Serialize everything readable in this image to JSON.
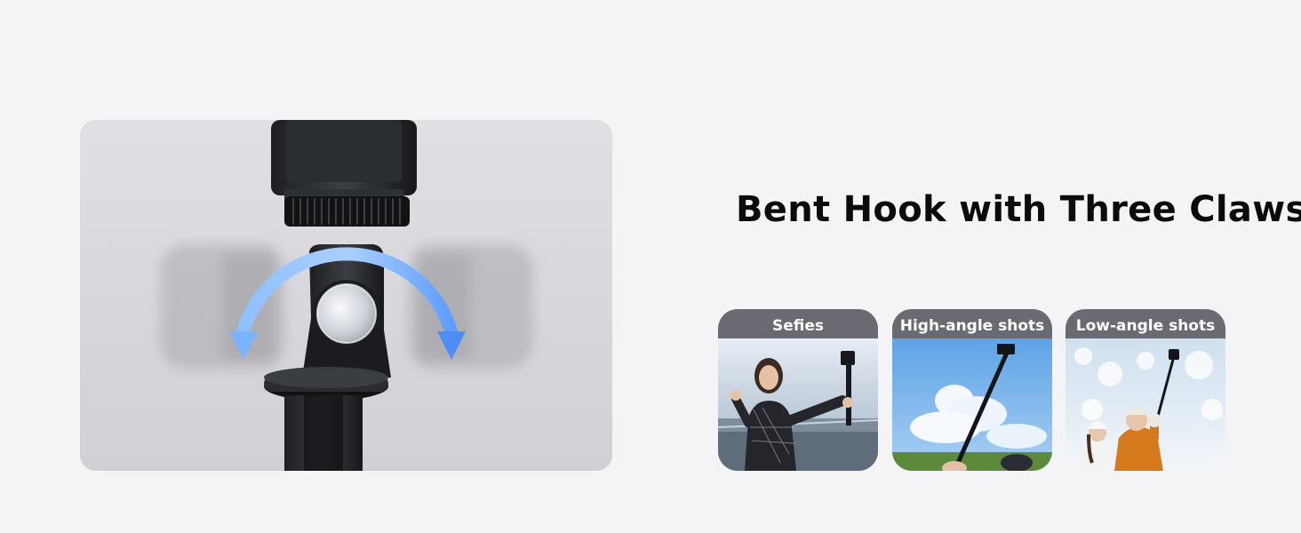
{
  "headline": "Bent Hook with Three Claws",
  "product_image": {
    "subject": "selfie stick phone mount with rotating ball joint",
    "icon": "rotation-arrow-icon",
    "accent_color": "#6aa6ff"
  },
  "cards": [
    {
      "label": "Sefies",
      "photo": "woman-selfie-city-photo"
    },
    {
      "label": "High-angle shots",
      "photo": "extended-stick-sky-photo"
    },
    {
      "label": "Low-angle shots",
      "photo": "couple-winter-selfie-photo"
    }
  ],
  "colors": {
    "background": "#f4f4f6",
    "card_header": "#6a6a73",
    "headline": "#0b0b0b"
  }
}
